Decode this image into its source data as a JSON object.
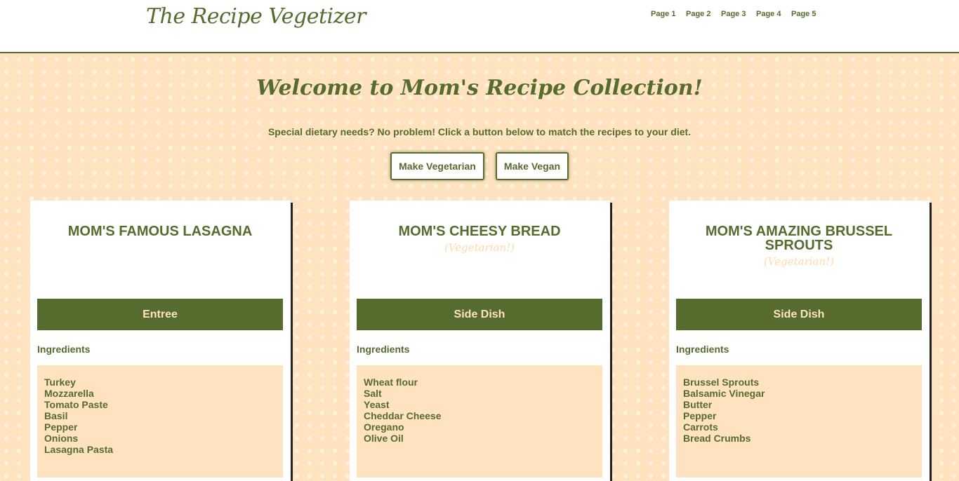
{
  "header": {
    "logo": "The Recipe Vegetizer",
    "nav": [
      "Page 1",
      "Page 2",
      "Page 3",
      "Page 4",
      "Page 5"
    ]
  },
  "main": {
    "welcome": "Welcome to Mom's Recipe Collection!",
    "subtext": "Special dietary needs? No problem! Click a button below to match the recipes to your diet.",
    "buttons": {
      "vegetarian": "Make Vegetarian",
      "vegan": "Make Vegan"
    }
  },
  "ingredients_label": "Ingredients",
  "cards": [
    {
      "title": "MOM'S FAMOUS LASAGNA",
      "tag": "",
      "category": "Entree",
      "ingredients": [
        "Turkey",
        "Mozzarella",
        "Tomato Paste",
        "Basil",
        "Pepper",
        "Onions",
        "Lasagna Pasta"
      ]
    },
    {
      "title": "MOM'S CHEESY BREAD",
      "tag": "(Vegetarian!)",
      "category": "Side Dish",
      "ingredients": [
        "Wheat flour",
        "Salt",
        "Yeast",
        "Cheddar Cheese",
        "Oregano",
        "Olive Oil"
      ]
    },
    {
      "title": "MOM'S AMAZING BRUSSEL SPROUTS",
      "tag": "(Vegetarian!)",
      "category": "Side Dish",
      "ingredients": [
        "Brussel Sprouts",
        "Balsamic Vinegar",
        "Butter",
        "Pepper",
        "Carrots",
        "Bread Crumbs"
      ]
    }
  ],
  "colors": {
    "accent": "#566b2e",
    "background": "#ffe2c0",
    "card": "#ffffff"
  }
}
